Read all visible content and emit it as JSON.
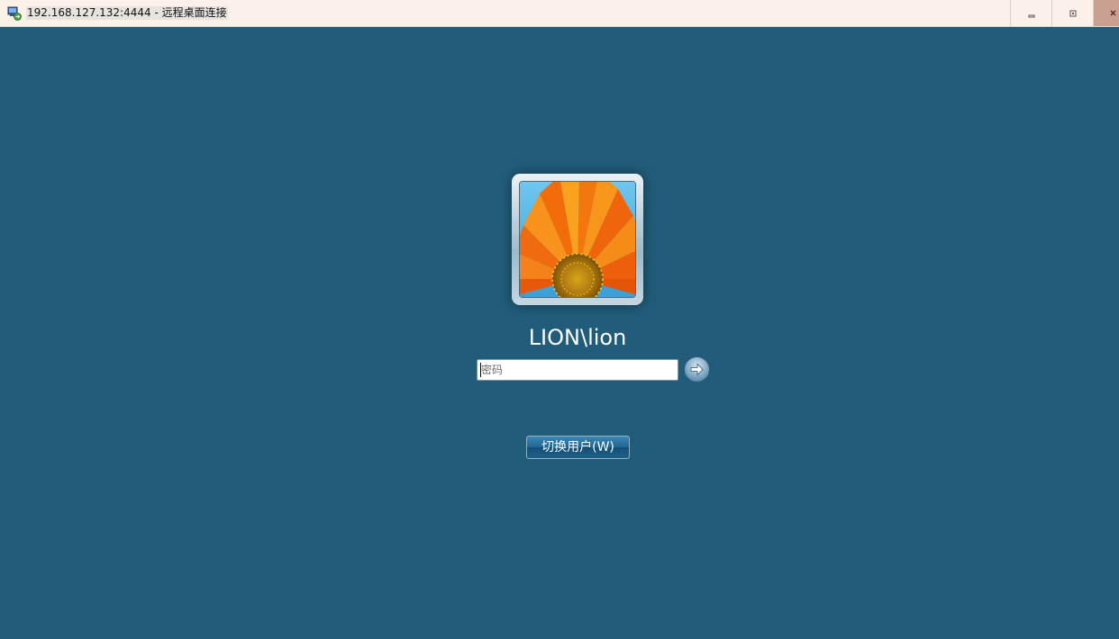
{
  "window": {
    "title": "192.168.127.132:4444 - 远程桌面连接",
    "app_icon": "remote-desktop-icon",
    "controls": [
      "minimize-icon",
      "restore-icon",
      "close-icon"
    ]
  },
  "login": {
    "avatar_icon": "flower-avatar",
    "username": "LION\\lion",
    "password_placeholder": "密码",
    "submit_icon": "arrow-right-icon",
    "switch_user_label": "切换用户(W)"
  },
  "colors": {
    "background": "#215d7a",
    "titlebar": "#fcf1e9",
    "close_button": "#c9a08f"
  }
}
